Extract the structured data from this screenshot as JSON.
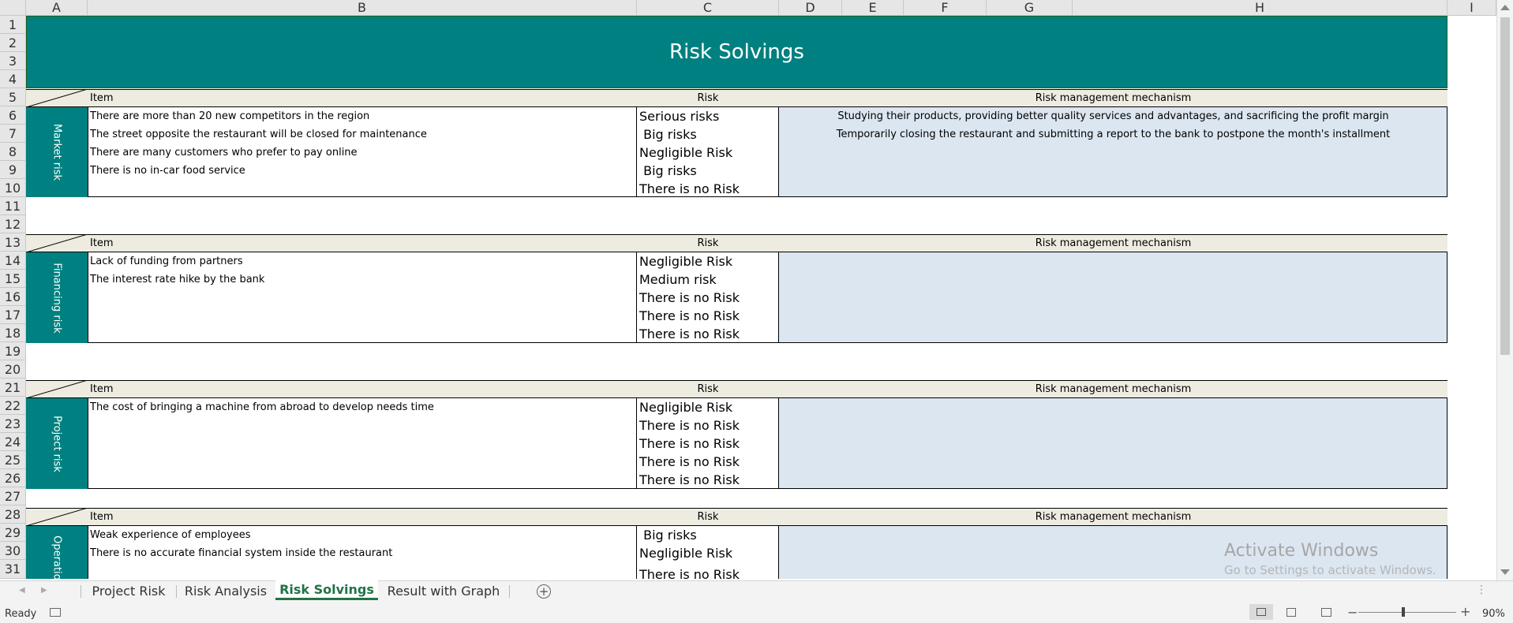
{
  "columns": [
    "A",
    "B",
    "C",
    "D",
    "E",
    "F",
    "G",
    "H",
    "I"
  ],
  "rows": [
    "1",
    "2",
    "3",
    "4",
    "5",
    "6",
    "7",
    "8",
    "9",
    "10",
    "11",
    "12",
    "13",
    "14",
    "15",
    "16",
    "17",
    "18",
    "19",
    "20",
    "21",
    "22",
    "23",
    "24",
    "25",
    "26",
    "27",
    "28",
    "29",
    "30",
    "31"
  ],
  "title": "Risk Solvings",
  "headers": {
    "item": "Item",
    "risk": "Risk",
    "mechanism": "Risk management mechanism"
  },
  "sections": [
    {
      "label": "Market risk",
      "items": [
        "There are more than 20 new competitors in the region",
        "The street opposite the restaurant will be closed for maintenance",
        "There are many customers who prefer to pay online",
        "There is no in-car food service",
        ""
      ],
      "risks": [
        "Serious risks",
        " Big risks",
        "Negligible Risk",
        " Big risks",
        "There is no Risk"
      ],
      "mechanisms": [
        "Studying their products, providing better quality services and advantages, and sacrificing the profit margin",
        "Temporarily closing the restaurant and submitting a report to the bank to postpone the month's installment",
        "",
        "",
        ""
      ]
    },
    {
      "label": "Financing risk",
      "items": [
        "Lack of funding from partners",
        "The interest rate hike by the bank",
        "",
        "",
        ""
      ],
      "risks": [
        "Negligible Risk",
        "Medium risk",
        "There is no Risk",
        "There is no Risk",
        "There is no Risk"
      ],
      "mechanisms": [
        "",
        "",
        "",
        "",
        ""
      ]
    },
    {
      "label": "Project risk",
      "items": [
        "The cost of bringing a machine from abroad to develop needs time",
        "",
        "",
        "",
        ""
      ],
      "risks": [
        "Negligible Risk",
        "There is no Risk",
        "There is no Risk",
        "There is no Risk",
        "There is no Risk"
      ],
      "mechanisms": [
        "",
        "",
        "",
        "",
        ""
      ]
    },
    {
      "label": "Operation",
      "items": [
        "Weak experience of employees",
        "There is no accurate financial system inside the restaurant",
        ""
      ],
      "risks": [
        " Big risks",
        "Negligible Risk",
        "There is no Risk"
      ],
      "mechanisms": [
        "",
        "",
        ""
      ]
    }
  ],
  "sheet_tabs": [
    "Project Risk",
    "Risk Analysis",
    "Risk Solvings",
    "Result with Graph"
  ],
  "active_tab": "Risk Solvings",
  "status": {
    "ready": "Ready",
    "zoom": "90%"
  },
  "watermark": {
    "line1": "Activate Windows",
    "line2": "Go to Settings to activate Windows."
  },
  "colors": {
    "teal": "#008080",
    "band": "#eeece1",
    "mechanism_fill": "#dce6f1",
    "active_tab": "#217346"
  }
}
